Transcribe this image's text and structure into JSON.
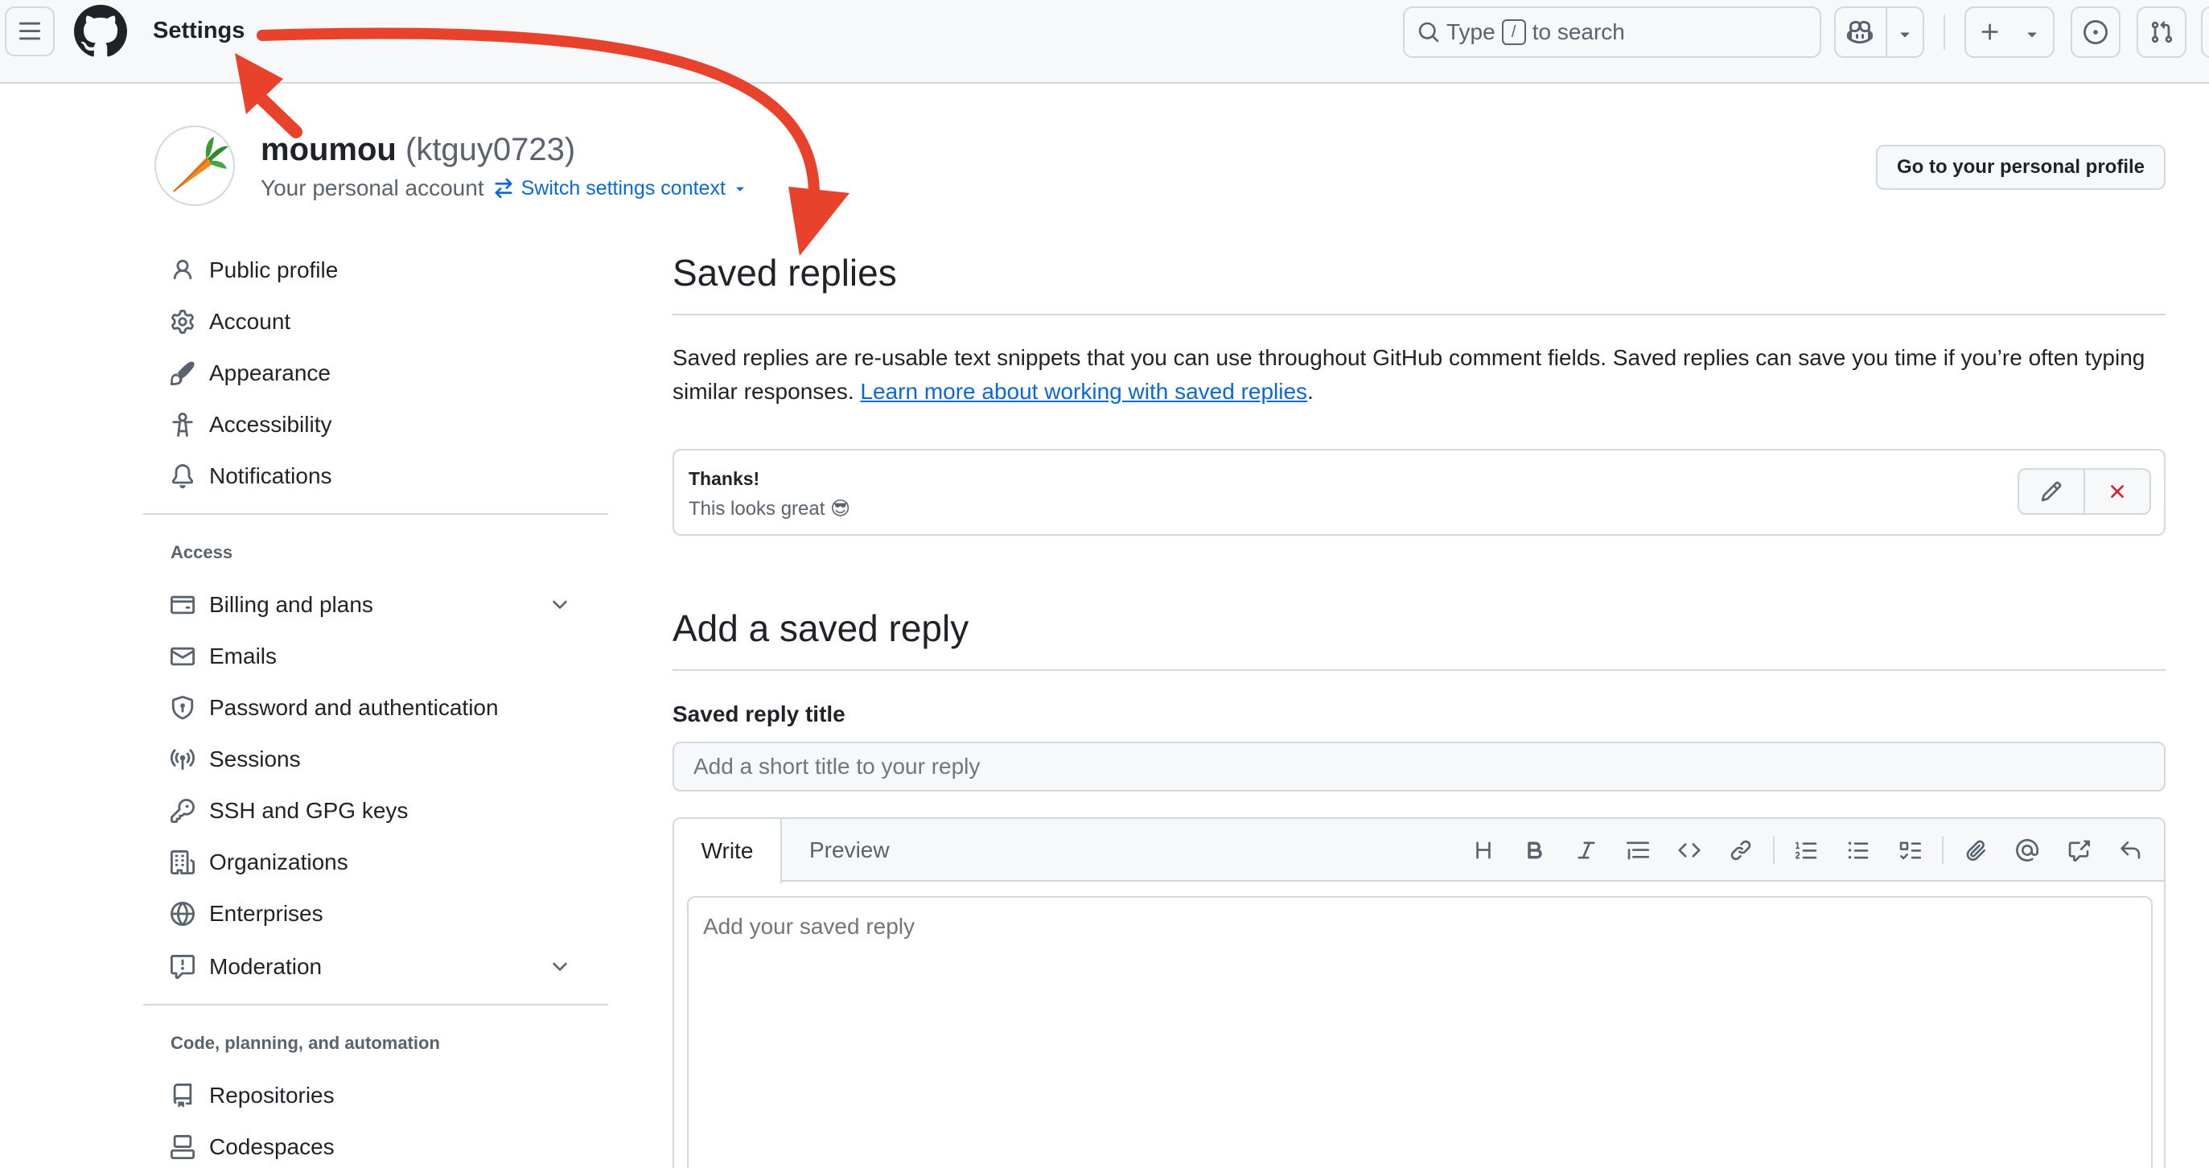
{
  "header": {
    "title": "Settings",
    "search": {
      "prefix": "Type",
      "key": "/",
      "suffix": "to search"
    }
  },
  "account": {
    "name": "moumou",
    "login": "(ktguy0723)",
    "subtitle": "Your personal account",
    "switch_label": "Switch settings context",
    "profile_button": "Go to your personal profile"
  },
  "sidebar": {
    "items": [
      {
        "label": "Public profile",
        "icon": "person-icon"
      },
      {
        "label": "Account",
        "icon": "gear-icon"
      },
      {
        "label": "Appearance",
        "icon": "paintbrush-icon"
      },
      {
        "label": "Accessibility",
        "icon": "accessibility-icon"
      },
      {
        "label": "Notifications",
        "icon": "bell-icon"
      }
    ],
    "access_heading": "Access",
    "access_items": [
      {
        "label": "Billing and plans",
        "icon": "credit-card-icon",
        "expandable": true
      },
      {
        "label": "Emails",
        "icon": "mail-icon"
      },
      {
        "label": "Password and authentication",
        "icon": "shield-lock-icon"
      },
      {
        "label": "Sessions",
        "icon": "broadcast-icon"
      },
      {
        "label": "SSH and GPG keys",
        "icon": "key-icon"
      },
      {
        "label": "Organizations",
        "icon": "organization-icon"
      },
      {
        "label": "Enterprises",
        "icon": "globe-icon"
      },
      {
        "label": "Moderation",
        "icon": "report-icon",
        "expandable": true
      }
    ],
    "code_heading": "Code, planning, and automation",
    "code_items": [
      {
        "label": "Repositories",
        "icon": "repo-icon"
      },
      {
        "label": "Codespaces",
        "icon": "codespaces-icon"
      }
    ]
  },
  "main": {
    "title": "Saved replies",
    "description": "Saved replies are re-usable text snippets that you can use throughout GitHub comment fields. Saved replies can save you time if you’re often typing similar responses.",
    "learn_more": "Learn more about working with saved replies",
    "saved_replies": [
      {
        "title": "Thanks!",
        "body": "This looks great 😎"
      }
    ],
    "add_title": "Add a saved reply",
    "reply_title_label": "Saved reply title",
    "reply_title_placeholder": "Add a short title to your reply",
    "tabs": {
      "write": "Write",
      "preview": "Preview"
    },
    "body_placeholder": "Add your saved reply"
  },
  "colors": {
    "accent": "#0969da",
    "annotation_arrow": "#e8412c",
    "danger": "#d1242f"
  }
}
